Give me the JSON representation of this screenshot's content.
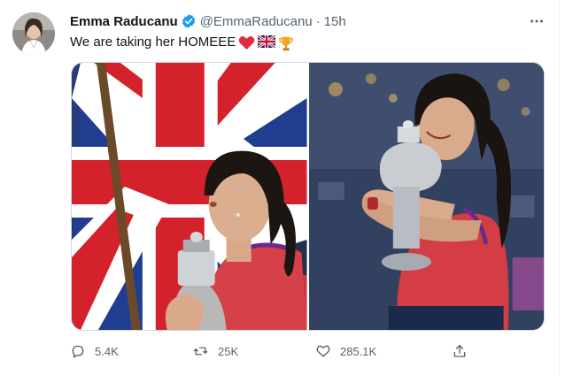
{
  "author": {
    "name": "Emma Raducanu",
    "handle": "@EmmaRaducanu",
    "separator": "·",
    "time": "15h"
  },
  "tweet": {
    "text": "We are taking her HOMEEE",
    "emojis": [
      "red-heart",
      "union-jack-flag",
      "trophy"
    ]
  },
  "media": [
    {
      "alt": "tennis player holding trophy in front of union jack flag"
    },
    {
      "alt": "tennis player laughing and hugging trophy"
    }
  ],
  "actions": {
    "replies": "5.4K",
    "retweets": "25K",
    "likes": "285.1K"
  },
  "colors": {
    "accent": "#1d9bf0",
    "secondary_text": "#536471",
    "heart": "#e0245e"
  }
}
